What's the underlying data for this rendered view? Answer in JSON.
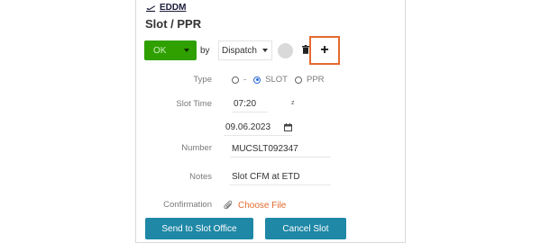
{
  "header": {
    "airport_code": "EDDM",
    "title": "Slot / PPR"
  },
  "toolbar": {
    "status_label": "OK",
    "status_color": "#2fa000",
    "by_label": "by",
    "source_selected": "Dispatch",
    "add_label": "+",
    "highlight_color": "#e36a2e"
  },
  "form": {
    "type_label": "Type",
    "type_options": [
      "-",
      "SLOT",
      "PPR"
    ],
    "type_selected": "SLOT",
    "slot_time_label": "Slot Time",
    "slot_time_value": "07:20",
    "slot_time_suffix": "z",
    "slot_date_value": "09.06.2023",
    "number_label": "Number",
    "number_value": "MUCSLT092347",
    "notes_label": "Notes",
    "notes_value": "Slot CFM at ETD",
    "confirmation_label": "Confirmation",
    "choose_file_label": "Choose File"
  },
  "actions": {
    "send_label": "Send to Slot Office",
    "cancel_label": "Cancel Slot",
    "button_color": "#1f88a6"
  },
  "icons": [
    "airplane-departure-icon",
    "trash-icon",
    "calendar-icon",
    "paperclip-icon",
    "chevron-down-icon"
  ]
}
